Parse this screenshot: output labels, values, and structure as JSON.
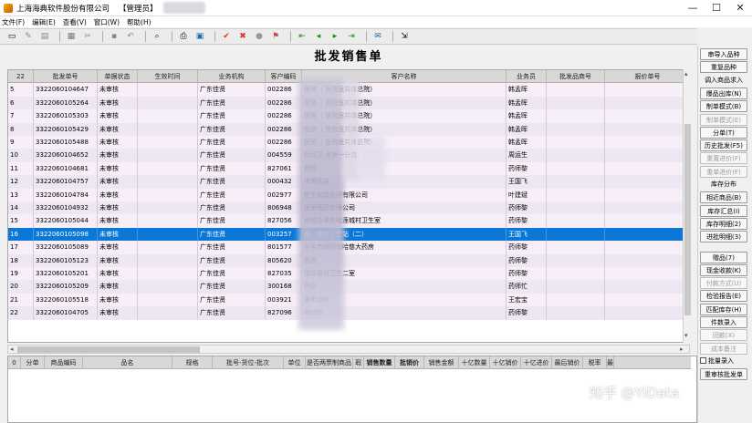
{
  "window": {
    "title": "上海海典软件股份有限公司",
    "role": "【管理员】"
  },
  "menu": [
    "文件(F)",
    "编辑(E)",
    "查看(V)",
    "窗口(W)",
    "帮助(H)"
  ],
  "form_title": "批发销售单",
  "grid": {
    "row_count": "22",
    "columns": [
      "批发单号",
      "单据状态",
      "生效时间",
      "业务机构",
      "客户编码",
      "客户名称",
      "业务员",
      "批发品商号",
      "报价单号"
    ],
    "rows": [
      {
        "n": "5",
        "order": "3322060104647",
        "status": "未审核",
        "org": "广东佳贤",
        "code": "002286",
        "name": "医院（     医院医共体总院）",
        "rep": "韩孟晖"
      },
      {
        "n": "6",
        "order": "3322060105264",
        "status": "未审核",
        "org": "广东佳贤",
        "code": "002286",
        "name": "医院（     医院医共体总院）",
        "rep": "韩孟晖"
      },
      {
        "n": "7",
        "order": "3322060105303",
        "status": "未审核",
        "org": "广东佳贤",
        "code": "002286",
        "name": "医院（     医院医共体总院）",
        "rep": "韩孟晖"
      },
      {
        "n": "8",
        "order": "3322060105429",
        "status": "未审核",
        "org": "广东佳贤",
        "code": "002286",
        "name": "医院（     医院医共体总院）",
        "rep": "韩孟晖"
      },
      {
        "n": "9",
        "order": "3322060105488",
        "status": "未审核",
        "org": "广东佳贤",
        "code": "002286",
        "name": "医院（     医院医共体总院）",
        "rep": "韩孟晖"
      },
      {
        "n": "10",
        "order": "3322060104652",
        "status": "未审核",
        "org": "广东佳贤",
        "code": "004559",
        "name": "社区卫     道第一分店",
        "rep": "周运生"
      },
      {
        "n": "11",
        "order": "3322060104681",
        "status": "未审核",
        "org": "广东佳贤",
        "code": "827061",
        "name": "健民",
        "rep": "药师黎"
      },
      {
        "n": "12",
        "order": "3322060104757",
        "status": "未审核",
        "org": "广东佳贤",
        "code": "000432",
        "name": "市湘药店",
        "rep": "王国飞"
      },
      {
        "n": "13",
        "order": "3322060104784",
        "status": "未审核",
        "org": "广东佳贤",
        "code": "002977",
        "name": "医生和堂医药有限公司",
        "rep": "叶建斌"
      },
      {
        "n": "14",
        "order": "3322060104932",
        "status": "未审核",
        "org": "广东佳贤",
        "code": "806948",
        "name": "世荣医药有限公司",
        "rep": "药师黎"
      },
      {
        "n": "15",
        "order": "3322060105044",
        "status": "未审核",
        "org": "广东佳贤",
        "code": "827056",
        "name": "尚德办事处哈莲城村卫生室",
        "rep": "药师黎"
      },
      {
        "n": "16",
        "order": "3322060105098",
        "status": "未审核",
        "org": "广东佳贤",
        "code": "003257",
        "name": "镇三塘村卫生站（二）",
        "rep": "王国飞"
      },
      {
        "n": "17",
        "order": "3322060105089",
        "status": "未审核",
        "org": "广东佳贤",
        "code": "801577",
        "name": "兰屯市朝阳街哈慈大药房",
        "rep": "药师黎"
      },
      {
        "n": "18",
        "order": "3322060105123",
        "status": "未审核",
        "org": "广东佳贤",
        "code": "805620",
        "name": "药店",
        "rep": "药师黎"
      },
      {
        "n": "19",
        "order": "3322060105201",
        "status": "未审核",
        "org": "广东佳贤",
        "code": "827035",
        "name": "镇龙泉村卫生二室",
        "rep": "药师黎"
      },
      {
        "n": "20",
        "order": "3322060105209",
        "status": "未审核",
        "org": "广东佳贤",
        "code": "300168",
        "name": "药店",
        "rep": "药师忙"
      },
      {
        "n": "21",
        "order": "3322060105518",
        "status": "未审核",
        "org": "广东佳贤",
        "code": "003921",
        "name": "惠年诊所",
        "rep": "王宏宝"
      },
      {
        "n": "22",
        "order": "3322060104705",
        "status": "未审核",
        "org": "广东佳贤",
        "code": "827096",
        "name": "林诊所",
        "rep": "药师黎"
      }
    ],
    "selected_index": 11
  },
  "detail": {
    "columns": [
      "0",
      "分单",
      "商品编码",
      "品名",
      "规格",
      "批号-货位-批次",
      "单位",
      "是否两票制商品",
      "瑕",
      "销售数量",
      "批销价",
      "销售金额",
      "十亿数量",
      "十亿销价",
      "十亿进价",
      "最后销价",
      "税率",
      "最"
    ]
  },
  "right_panel": [
    {
      "type": "button",
      "label": "串导入品种"
    },
    {
      "type": "button",
      "label": "重复品种"
    },
    {
      "type": "label",
      "label": "调入商品求入"
    },
    {
      "type": "button",
      "label": "爆品出库(N)"
    },
    {
      "type": "button",
      "label": "制单模式(B)"
    },
    {
      "type": "button",
      "label": "制单模式(E)",
      "disabled": true
    },
    {
      "type": "button",
      "label": "分单(T)"
    },
    {
      "type": "button",
      "label": "历史批发(F5)"
    },
    {
      "type": "button",
      "label": "重置进价(F)",
      "disabled": true
    },
    {
      "type": "button",
      "label": "重单进价(F)",
      "disabled": true
    },
    {
      "type": "label",
      "label": "库存分布"
    },
    {
      "type": "button",
      "label": "相近商品(B)"
    },
    {
      "type": "button",
      "label": "库存汇总(I)"
    },
    {
      "type": "button",
      "label": "库存明细(2)"
    },
    {
      "type": "button",
      "label": "进批明细(3)"
    },
    {
      "type": "gap"
    },
    {
      "type": "button",
      "label": "赠品(7)"
    },
    {
      "type": "button",
      "label": "现金收款(K)"
    },
    {
      "type": "button",
      "label": "付款方式(U)",
      "disabled": true
    },
    {
      "type": "button",
      "label": "检验报告(E)"
    },
    {
      "type": "button",
      "label": "匹配库存(H)"
    },
    {
      "type": "button",
      "label": "件数录入"
    },
    {
      "type": "button",
      "label": "回款(X)",
      "disabled": true
    },
    {
      "type": "button",
      "label": "成本备注",
      "disabled": true
    },
    {
      "type": "check",
      "label": "批量录入"
    },
    {
      "type": "button",
      "label": "重审核批发单"
    }
  ],
  "watermark": "知乎 @YiData",
  "colors": {
    "selected_row": "#0b78d8",
    "row_odd": "#f8eef7",
    "row_even": "#ede6f3",
    "header": "#d8d8d8"
  }
}
